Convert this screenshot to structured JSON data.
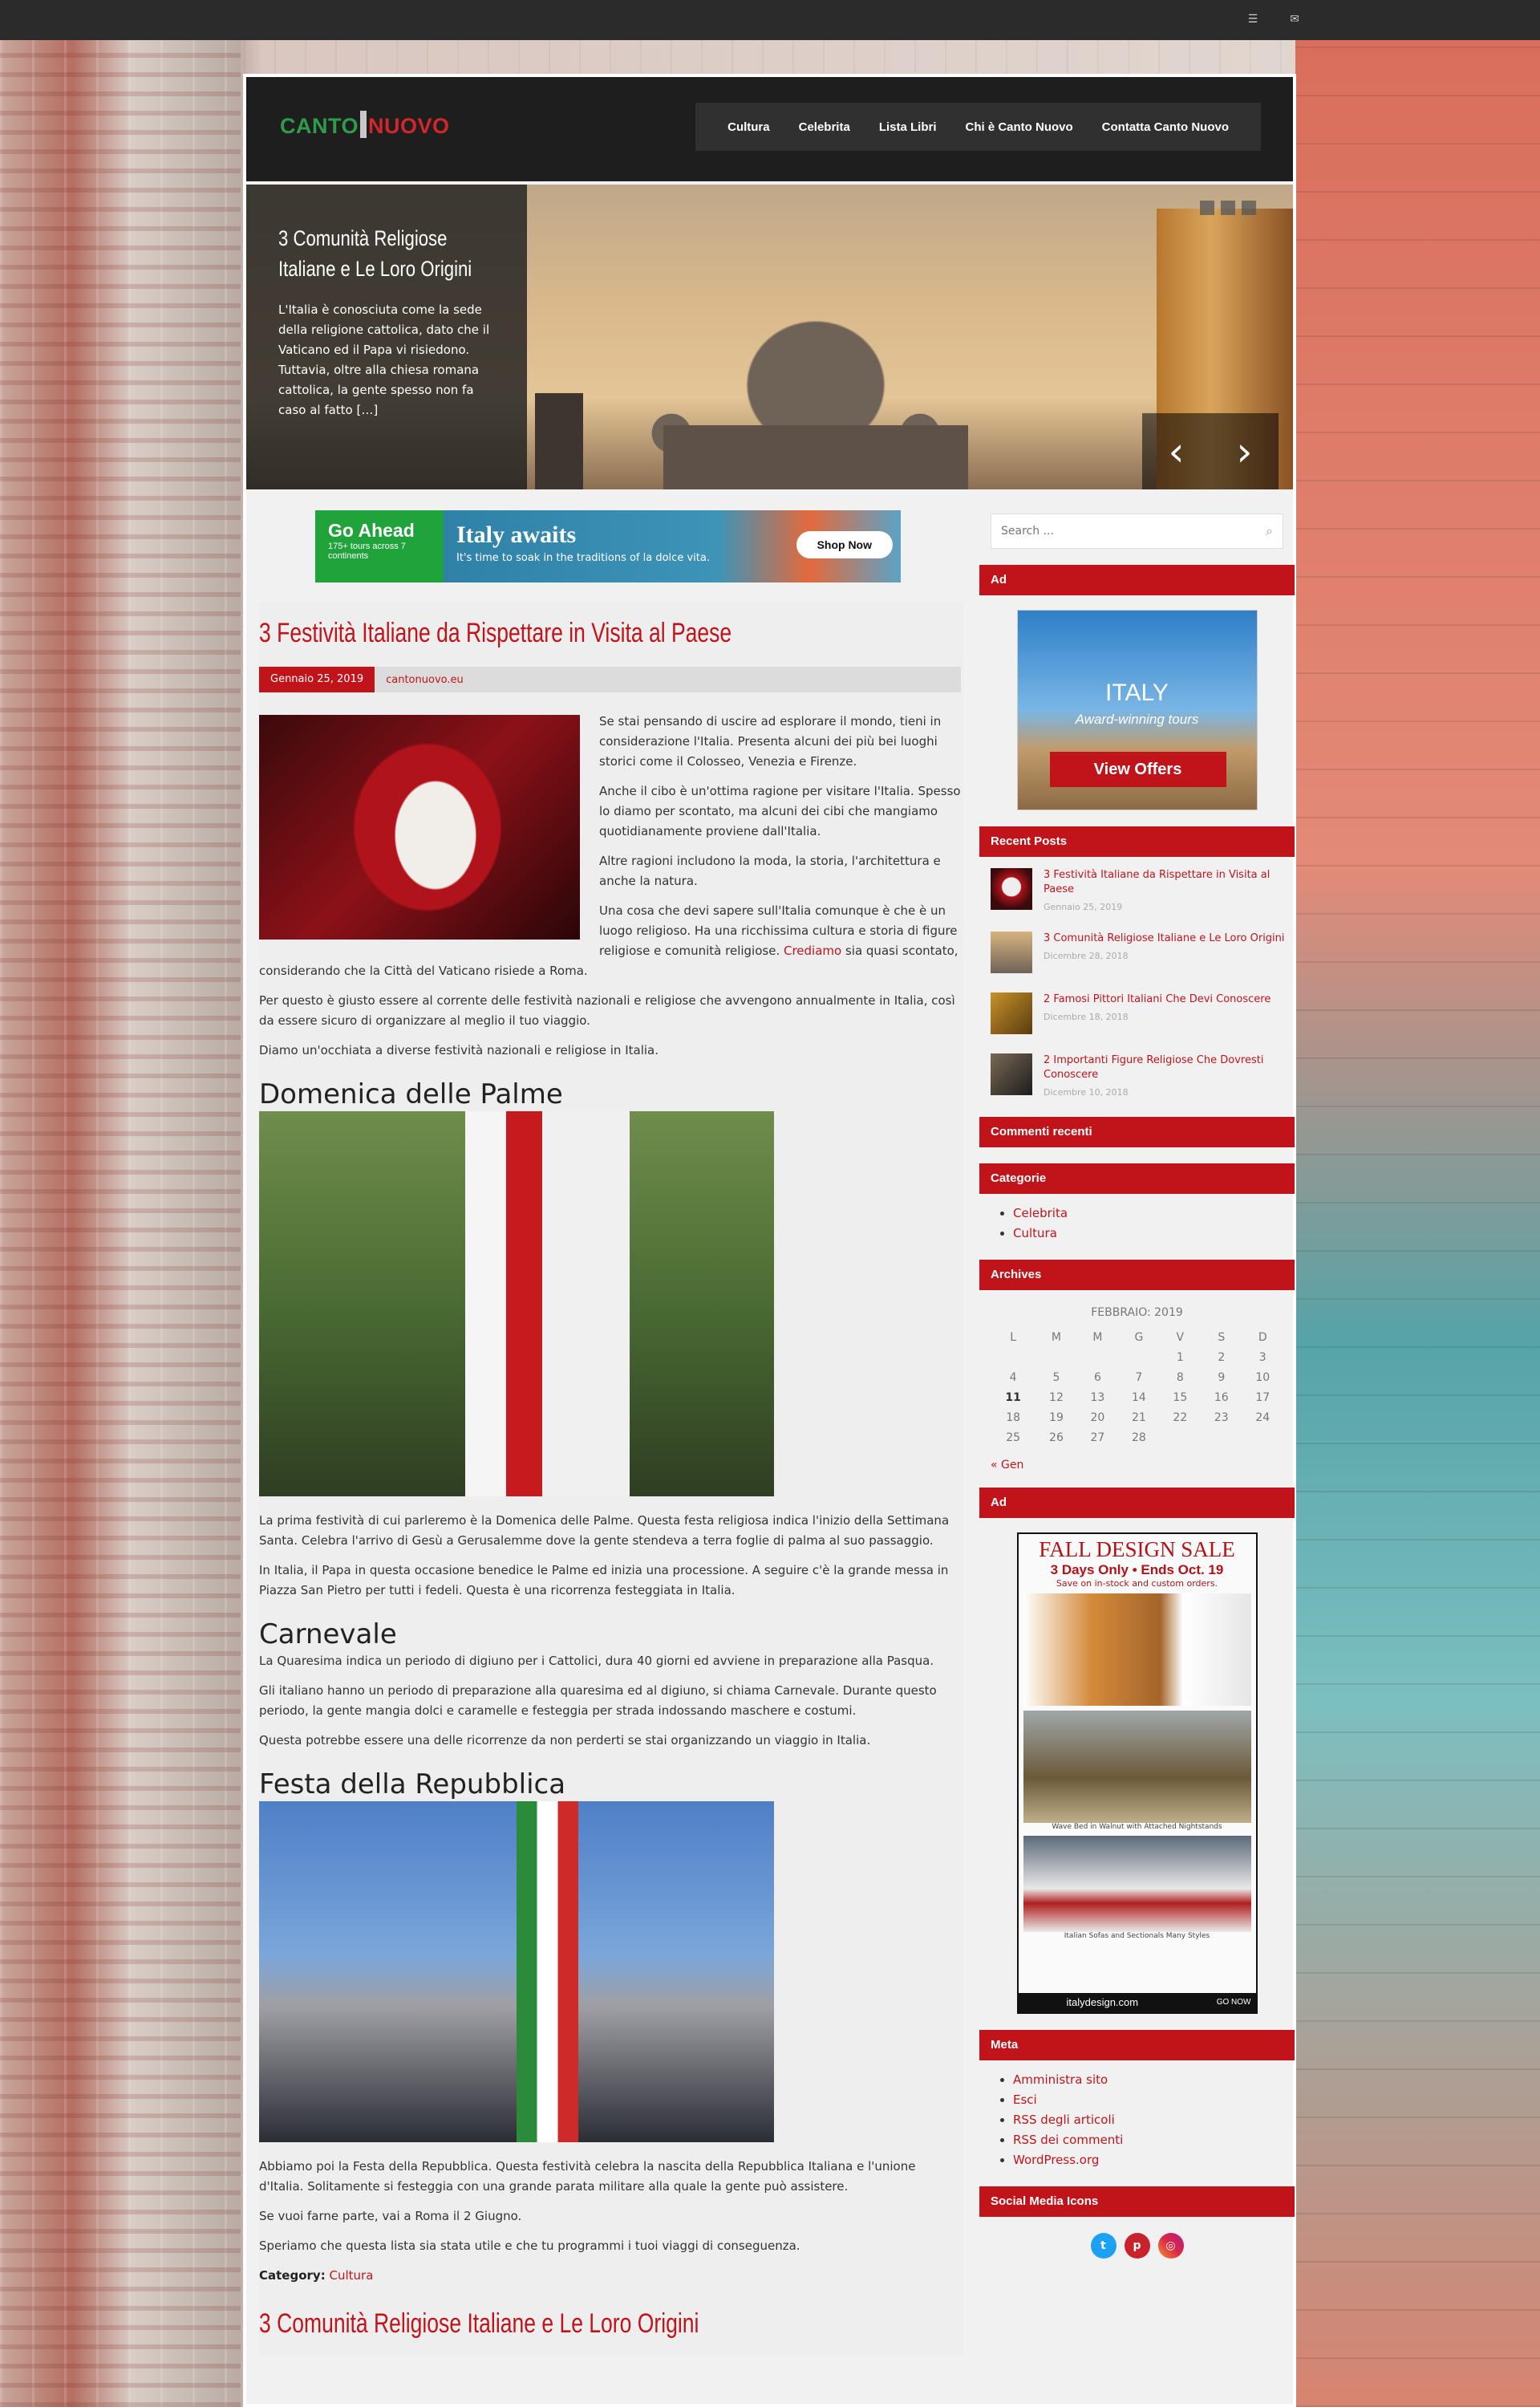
{
  "topbar": {
    "rss_icon": "rss-icon",
    "mail_icon": "mail-icon"
  },
  "header": {
    "logo_left": "CANTO",
    "logo_right": "NUOVO",
    "nav": [
      "Cultura",
      "Celebrita",
      "Lista Libri",
      "Chi è Canto Nuovo",
      "Contatta Canto Nuovo"
    ]
  },
  "slider": {
    "title": "3 Comunità Religiose Italiane e Le Loro Origini",
    "excerpt": "L'Italia è conosciuta come la sede della  religione cattolica, dato che il Vaticano ed il Papa vi risiedono. Tuttavia, oltre alla chiesa romana cattolica, la gente spesso non fa caso al fatto […]",
    "prev": "‹",
    "next": "›"
  },
  "banner": {
    "brand": "Go Ahead",
    "brand_sub": "175+ tours across 7 continents",
    "headline": "Italy awaits",
    "subline": "It's time to soak in the traditions of la dolce vita.",
    "cta": "Shop Now"
  },
  "post": {
    "title": "3 Festività Italiane da Rispettare in Visita al Paese",
    "date": "Gennaio 25, 2019",
    "author": "cantonuovo.eu",
    "p1": "Se stai pensando di uscire ad esplorare il mondo, tieni in considerazione l'Italia. Presenta  alcuni dei più bei luoghi storici come il Colosseo, Venezia e Firenze.",
    "p2": "Anche il cibo è un'ottima ragione per visitare l'Italia. Spesso lo diamo per scontato, ma alcuni dei cibi che mangiamo quotidianamente proviene dall'Italia.",
    "p3": "Altre ragioni includono la moda, la storia, l'architettura e anche la natura.",
    "p4a": "Una cosa che devi sapere sull'Italia comunque è che è un luogo religioso. Ha una ricchissima cultura e storia di figure religiose e comunità religiose. ",
    "p4link": "Crediamo",
    "p4b": " sia quasi scontato, considerando che la Città del Vaticano risiede a Roma.",
    "p5": "Per questo è giusto essere al corrente delle festività nazionali e religiose che avvengono annualmente in Italia, così da essere sicuro di organizzare al meglio il tuo viaggio.",
    "p6": "Diamo un'occhiata a diverse festività nazionali e religiose in Italia.",
    "h_palme": "Domenica delle Palme",
    "palme1": "La prima festività di cui parleremo è la Domenica delle Palme. Questa festa religiosa indica l'inizio della Settimana Santa. Celebra l'arrivo di Gesù a Gerusalemme dove la gente stendeva a terra foglie di palma al suo passaggio.",
    "palme2": "In Italia, il Papa in questa occasione benedice le Palme ed inizia una processione. A seguire c'è la grande messa in Piazza San Pietro per tutti i fedeli. Questa è una ricorrenza festeggiata in Italia.",
    "h_carn": "Carnevale",
    "carn1": "La Quaresima indica un periodo di digiuno per i Cattolici, dura 40 giorni ed avviene in preparazione alla Pasqua.",
    "carn2": "Gli italiano hanno un periodo di preparazione alla quaresima ed al digiuno, si chiama Carnevale. Durante questo periodo, la gente mangia dolci e caramelle e festeggia per strada indossando maschere e costumi.",
    "carn3": "Questa potrebbe essere una delle ricorrenze da non perderti se stai organizzando un viaggio in Italia.",
    "h_rep": "Festa della Repubblica",
    "rep1": "Abbiamo poi la Festa della Repubblica. Questa festività celebra la nascita della Repubblica Italiana e l'unione d'Italia. Solitamente si festeggia con una grande parata militare alla quale la gente può assistere.",
    "rep2": "Se vuoi farne parte, vai a Roma il 2 Giugno.",
    "rep3": "Speriamo che questa lista sia stata utile e che tu programmi i tuoi viaggi di conseguenza.",
    "category_label": "Category:",
    "category": "Cultura"
  },
  "next_post_title": "3 Comunità Religiose Italiane e Le Loro Origini",
  "sidebar": {
    "search_placeholder": "Search ...",
    "ad_title": "Ad",
    "ad1_title": "ITALY",
    "ad1_sub": "Award-winning tours",
    "ad1_cta": "View Offers",
    "recent_title": "Recent Posts",
    "recent": [
      {
        "title": "3 Festività Italiane da Rispettare in Visita al Paese",
        "date": "Gennaio 25, 2019"
      },
      {
        "title": "3 Comunità Religiose Italiane e Le Loro Origini",
        "date": "Dicembre 28, 2018"
      },
      {
        "title": "2 Famosi Pittori Italiani Che Devi Conoscere",
        "date": "Dicembre 18, 2018"
      },
      {
        "title": "2 Importanti Figure Religiose Che Dovresti Conoscere",
        "date": "Dicembre 10, 2018"
      }
    ],
    "comments_title": "Commenti recenti",
    "categories_title": "Categorie",
    "categories": [
      "Celebrita",
      "Cultura"
    ],
    "archives_title": "Archives",
    "calendar": {
      "caption": "FEBBRAIO: 2019",
      "headers": [
        "L",
        "M",
        "M",
        "G",
        "V",
        "S",
        "D"
      ],
      "rows": [
        [
          "",
          "",
          "",
          "",
          "1",
          "2",
          "3"
        ],
        [
          "4",
          "5",
          "6",
          "7",
          "8",
          "9",
          "10"
        ],
        [
          "11",
          "12",
          "13",
          "14",
          "15",
          "16",
          "17"
        ],
        [
          "18",
          "19",
          "20",
          "21",
          "22",
          "23",
          "24"
        ],
        [
          "25",
          "26",
          "27",
          "28",
          "",
          "",
          ""
        ]
      ],
      "prev": "« Gen"
    },
    "ad2_title": "Ad",
    "ad2_h1": "FALL DESIGN SALE",
    "ad2_h2": "3 Days Only • Ends Oct. 19",
    "ad2_h3": "Save on in-stock and custom orders.",
    "ad2_cap1": "Wave Bed in Walnut with Attached Nightstands",
    "ad2_cap2": "Italian Sofas and Sectionals Many Styles",
    "ad2_url": "italydesign.com",
    "ad2_go": "GO NOW",
    "meta_title": "Meta",
    "meta": [
      "Amministra sito",
      "Esci",
      "RSS degli articoli",
      "RSS dei commenti",
      "WordPress.org"
    ],
    "social_title": "Social Media Icons"
  }
}
